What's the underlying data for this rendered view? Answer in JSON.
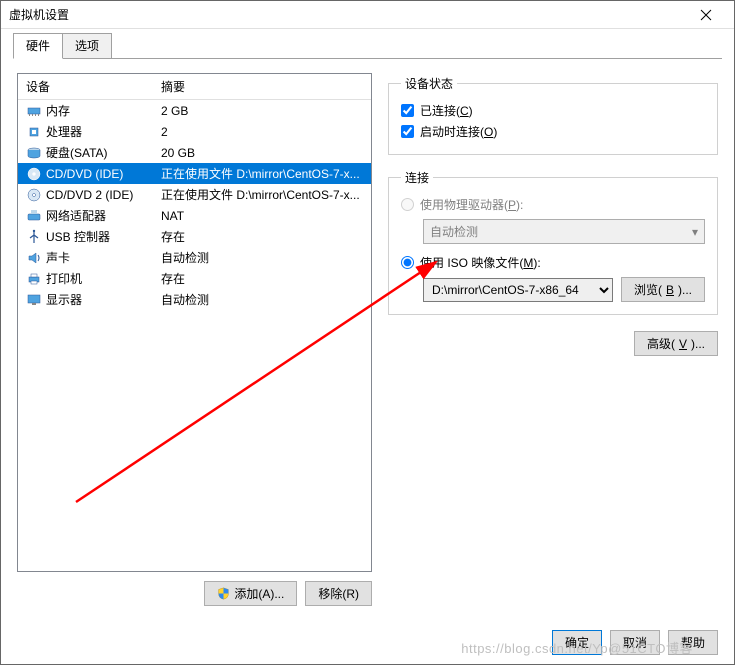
{
  "window": {
    "title": "虚拟机设置"
  },
  "tabs": [
    {
      "label": "硬件",
      "active": true
    },
    {
      "label": "选项",
      "active": false
    }
  ],
  "deviceList": {
    "headers": {
      "device": "设备",
      "summary": "摘要"
    },
    "rows": [
      {
        "icon": "memory",
        "device": "内存",
        "summary": "2 GB",
        "selected": false
      },
      {
        "icon": "cpu",
        "device": "处理器",
        "summary": "2",
        "selected": false
      },
      {
        "icon": "disk",
        "device": "硬盘(SATA)",
        "summary": "20 GB",
        "selected": false
      },
      {
        "icon": "cd",
        "device": "CD/DVD (IDE)",
        "summary": "正在使用文件 D:\\mirror\\CentOS-7-x...",
        "selected": true
      },
      {
        "icon": "cd",
        "device": "CD/DVD 2 (IDE)",
        "summary": "正在使用文件 D:\\mirror\\CentOS-7-x...",
        "selected": false
      },
      {
        "icon": "net",
        "device": "网络适配器",
        "summary": "NAT",
        "selected": false
      },
      {
        "icon": "usb",
        "device": "USB 控制器",
        "summary": "存在",
        "selected": false
      },
      {
        "icon": "sound",
        "device": "声卡",
        "summary": "自动检测",
        "selected": false
      },
      {
        "icon": "printer",
        "device": "打印机",
        "summary": "存在",
        "selected": false
      },
      {
        "icon": "display",
        "device": "显示器",
        "summary": "自动检测",
        "selected": false
      }
    ]
  },
  "listButtons": {
    "add": "添加(A)...",
    "remove": "移除(R)"
  },
  "deviceStatus": {
    "legend": "设备状态",
    "connected": {
      "label_pre": "已连接(",
      "key": "C",
      "label_post": ")",
      "checked": true
    },
    "connectAtPower": {
      "label_pre": "启动时连接(",
      "key": "O",
      "label_post": ")",
      "checked": true
    }
  },
  "connection": {
    "legend": "连接",
    "physical": {
      "label_pre": "使用物理驱动器(",
      "key": "P",
      "label_post": "):",
      "checked": false,
      "dropdown": "自动检测"
    },
    "iso": {
      "label_pre": "使用 ISO 映像文件(",
      "key": "M",
      "label_post": "):",
      "checked": true,
      "path": "D:\\mirror\\CentOS-7-x86_64"
    },
    "browse": {
      "pre": "浏览(",
      "key": "B",
      "post": ")..."
    }
  },
  "advanced": {
    "pre": "高级(",
    "key": "V",
    "post": ")..."
  },
  "footer": {
    "ok": "确定",
    "cancel": "取消",
    "help": "帮助"
  },
  "watermark": "https://blog.csdn.net/Yp@51CTO博客"
}
